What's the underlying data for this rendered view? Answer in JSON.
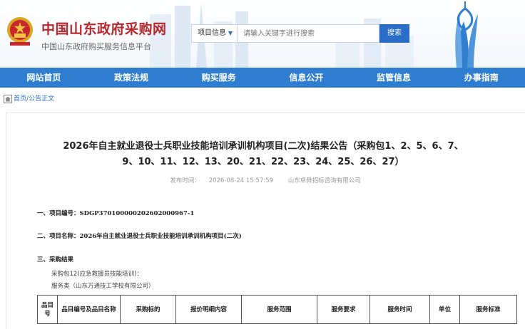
{
  "header": {
    "site_title": "中国山东政府采购网",
    "site_subtitle": "中国山东政府购买服务信息平台",
    "search": {
      "scope_label": "项目信息",
      "placeholder": "请输入关键字进行搜索",
      "button_label": "搜索"
    }
  },
  "nav": {
    "items": [
      "网站首页",
      "政策法规",
      "购买服务",
      "信息公开",
      "监管信息",
      "办事指南"
    ]
  },
  "breadcrumb": {
    "home": "首页",
    "separator": "/",
    "current": "公告正文"
  },
  "article": {
    "title_line1": "2026年自主就业退役士兵职业技能培训承训机构项目(二次)结果公告（采购包1、2、5、6、7、",
    "title_line2": "9、10、11、12、13、20、21、22、23、24、25、26、27）",
    "publish_label": "发布时间：",
    "publish_time": "2026-08-24 15:57:59",
    "agency": "山东卓舜招标咨询有限公司",
    "sections": {
      "project_no_label": "一、项目编号：",
      "project_no": "SDGP370100000202602000967-1",
      "project_name_label": "二、项目名称：",
      "project_name": "2026年自主就业退役士兵职业技能培训承训机构项目(二次)",
      "results_label": "三、采购结果",
      "package": "采购包12(应急救援员技能培训)：",
      "service_line": "服务类（山东万通技工学校有限公司）"
    },
    "table_headers": [
      "品目号",
      "品目编号及品目名称",
      "采购标的",
      "报价明细内容",
      "服务范围",
      "服务要求",
      "服务时间",
      "单位",
      "服务标准"
    ]
  },
  "colors": {
    "brand_red": "#b8262b",
    "nav_blue": "#2e7dd1",
    "link_blue": "#2b6cc7"
  }
}
